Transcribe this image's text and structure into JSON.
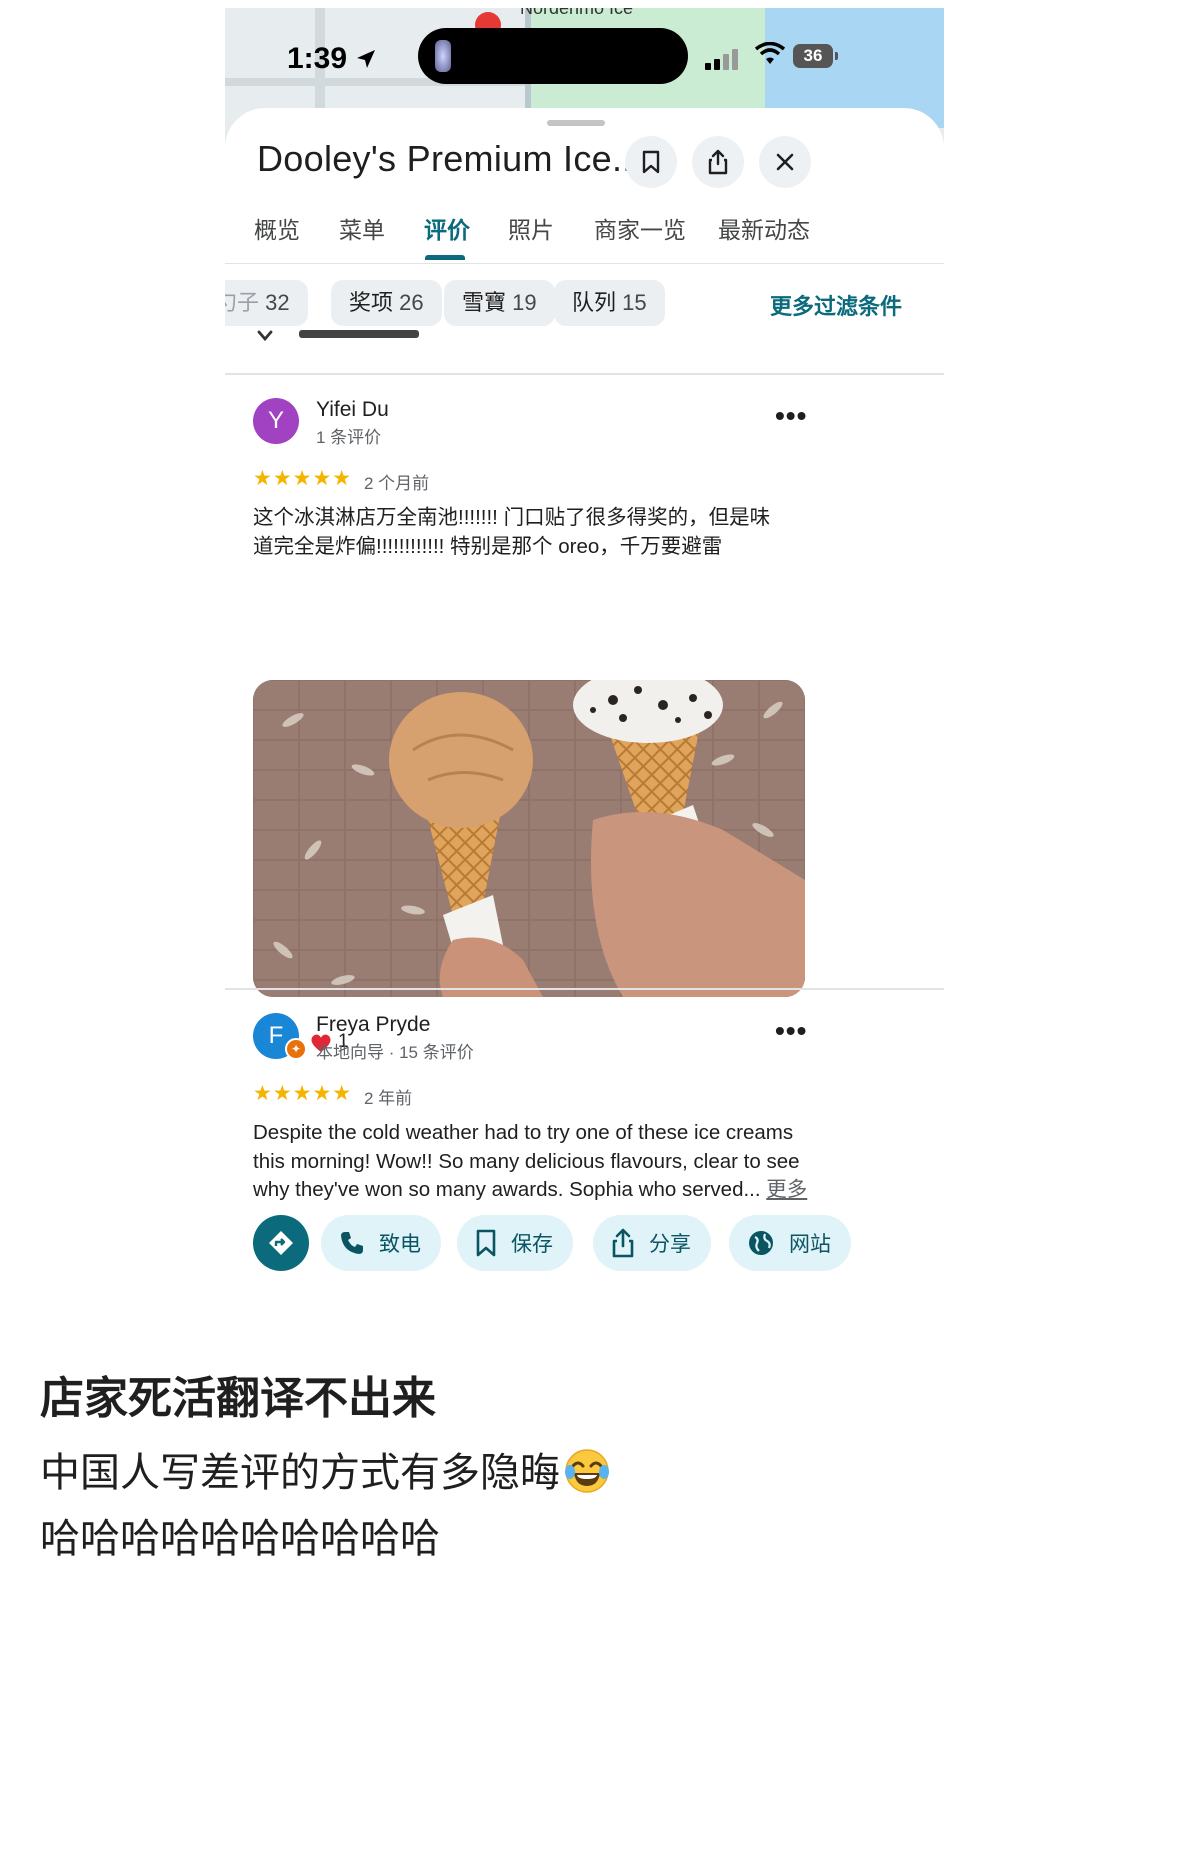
{
  "status_bar": {
    "time": "1:39",
    "battery": "36"
  },
  "map": {
    "label": "Nordenmo Ice"
  },
  "place": {
    "title": "Dooley's Premium Ice..."
  },
  "tabs": [
    {
      "label": "概览"
    },
    {
      "label": "菜单"
    },
    {
      "label": "评价",
      "active": true
    },
    {
      "label": "照片"
    },
    {
      "label": "商家一览"
    },
    {
      "label": "最新动态"
    }
  ],
  "filters": {
    "chips": [
      {
        "label": "勺子",
        "count": "32"
      },
      {
        "label": "奖项",
        "count": "26"
      },
      {
        "label": "雪寶",
        "count": "19"
      },
      {
        "label": "队列",
        "count": "15"
      }
    ],
    "more": "更多过滤条件"
  },
  "reviews": [
    {
      "avatar_letter": "Y",
      "avatar_color": "#a142c2",
      "name": "Yifei Du",
      "meta": "1 条评价",
      "stars": "★★★★★",
      "age": "2 个月前",
      "text_line1": "这个冰淇淋店万全南池!!!!!!! 门口贴了很多得奖的，但是味",
      "text_line2": "道完全是炸偏!!!!!!!!!!!! 特别是那个 oreo，千万要避雷",
      "likes": "1"
    },
    {
      "avatar_letter": "F",
      "avatar_color": "#1a87d6",
      "name": "Freya Pryde",
      "meta": "本地向导 · 15 条评价",
      "stars": "★★★★★",
      "age": "2 年前",
      "text_line1": "Despite the cold weather had to try one of these ice creams",
      "text_line2": "this morning! Wow!! So many delicious flavours, clear to see",
      "text_line3": "why they've won so many awards. Sophia who served...",
      "more": "更多"
    }
  ],
  "actions": {
    "call": "致电",
    "save": "保存",
    "share": "分享",
    "website": "网站"
  },
  "caption": {
    "line1": "店家死活翻译不出来",
    "line2": "中国人写差评的方式有多隐晦",
    "line3": "哈哈哈哈哈哈哈哈哈哈"
  },
  "colors": {
    "accent": "#0b6a7b",
    "star": "#f4b400",
    "chip_bg": "#eceff1",
    "action_bg": "#dff3f9"
  },
  "icons": [
    "location-arrow-icon",
    "wifi-icon",
    "bookmark-icon",
    "share-icon",
    "close-icon",
    "chevron-down-icon",
    "more-icon",
    "heart-outline-icon",
    "heart-filled-icon",
    "directions-icon",
    "phone-icon",
    "globe-icon",
    "laughing-emoji-icon"
  ]
}
